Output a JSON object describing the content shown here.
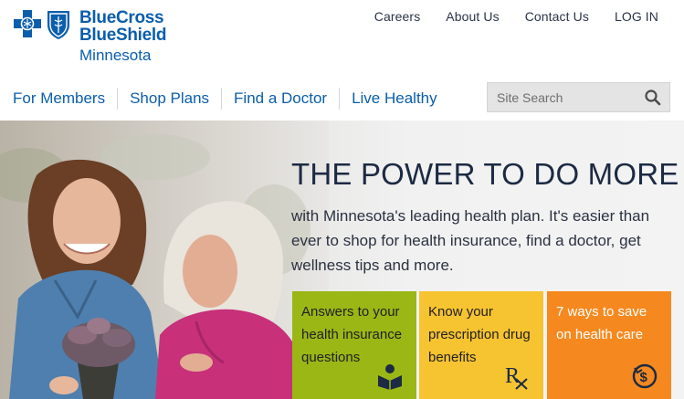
{
  "brand": {
    "line1": "BlueCross",
    "line2": "BlueShield",
    "state": "Minnesota",
    "color": "#0a5eab"
  },
  "utility_nav": [
    "Careers",
    "About Us",
    "Contact Us",
    "LOG IN"
  ],
  "main_nav": [
    "For Members",
    "Shop Plans",
    "Find a Doctor",
    "Live Healthy"
  ],
  "search": {
    "placeholder": "Site Search",
    "icon": "search-icon"
  },
  "hero": {
    "headline": "THE POWER TO DO MORE",
    "subtext": "with Minnesota's leading health plan. It's easier than ever to shop for health insurance, find a doctor, get wellness tips and more."
  },
  "tiles": [
    {
      "label": "Answers to your health insurance questions",
      "icon": "book-reader-icon",
      "color": "#9ab716"
    },
    {
      "label": "Know your prescription drug benefits",
      "icon": "rx-icon",
      "color": "#f6c331"
    },
    {
      "label": "7 ways to save on health care",
      "icon": "dollar-cycle-icon",
      "color": "#f5891f"
    }
  ]
}
